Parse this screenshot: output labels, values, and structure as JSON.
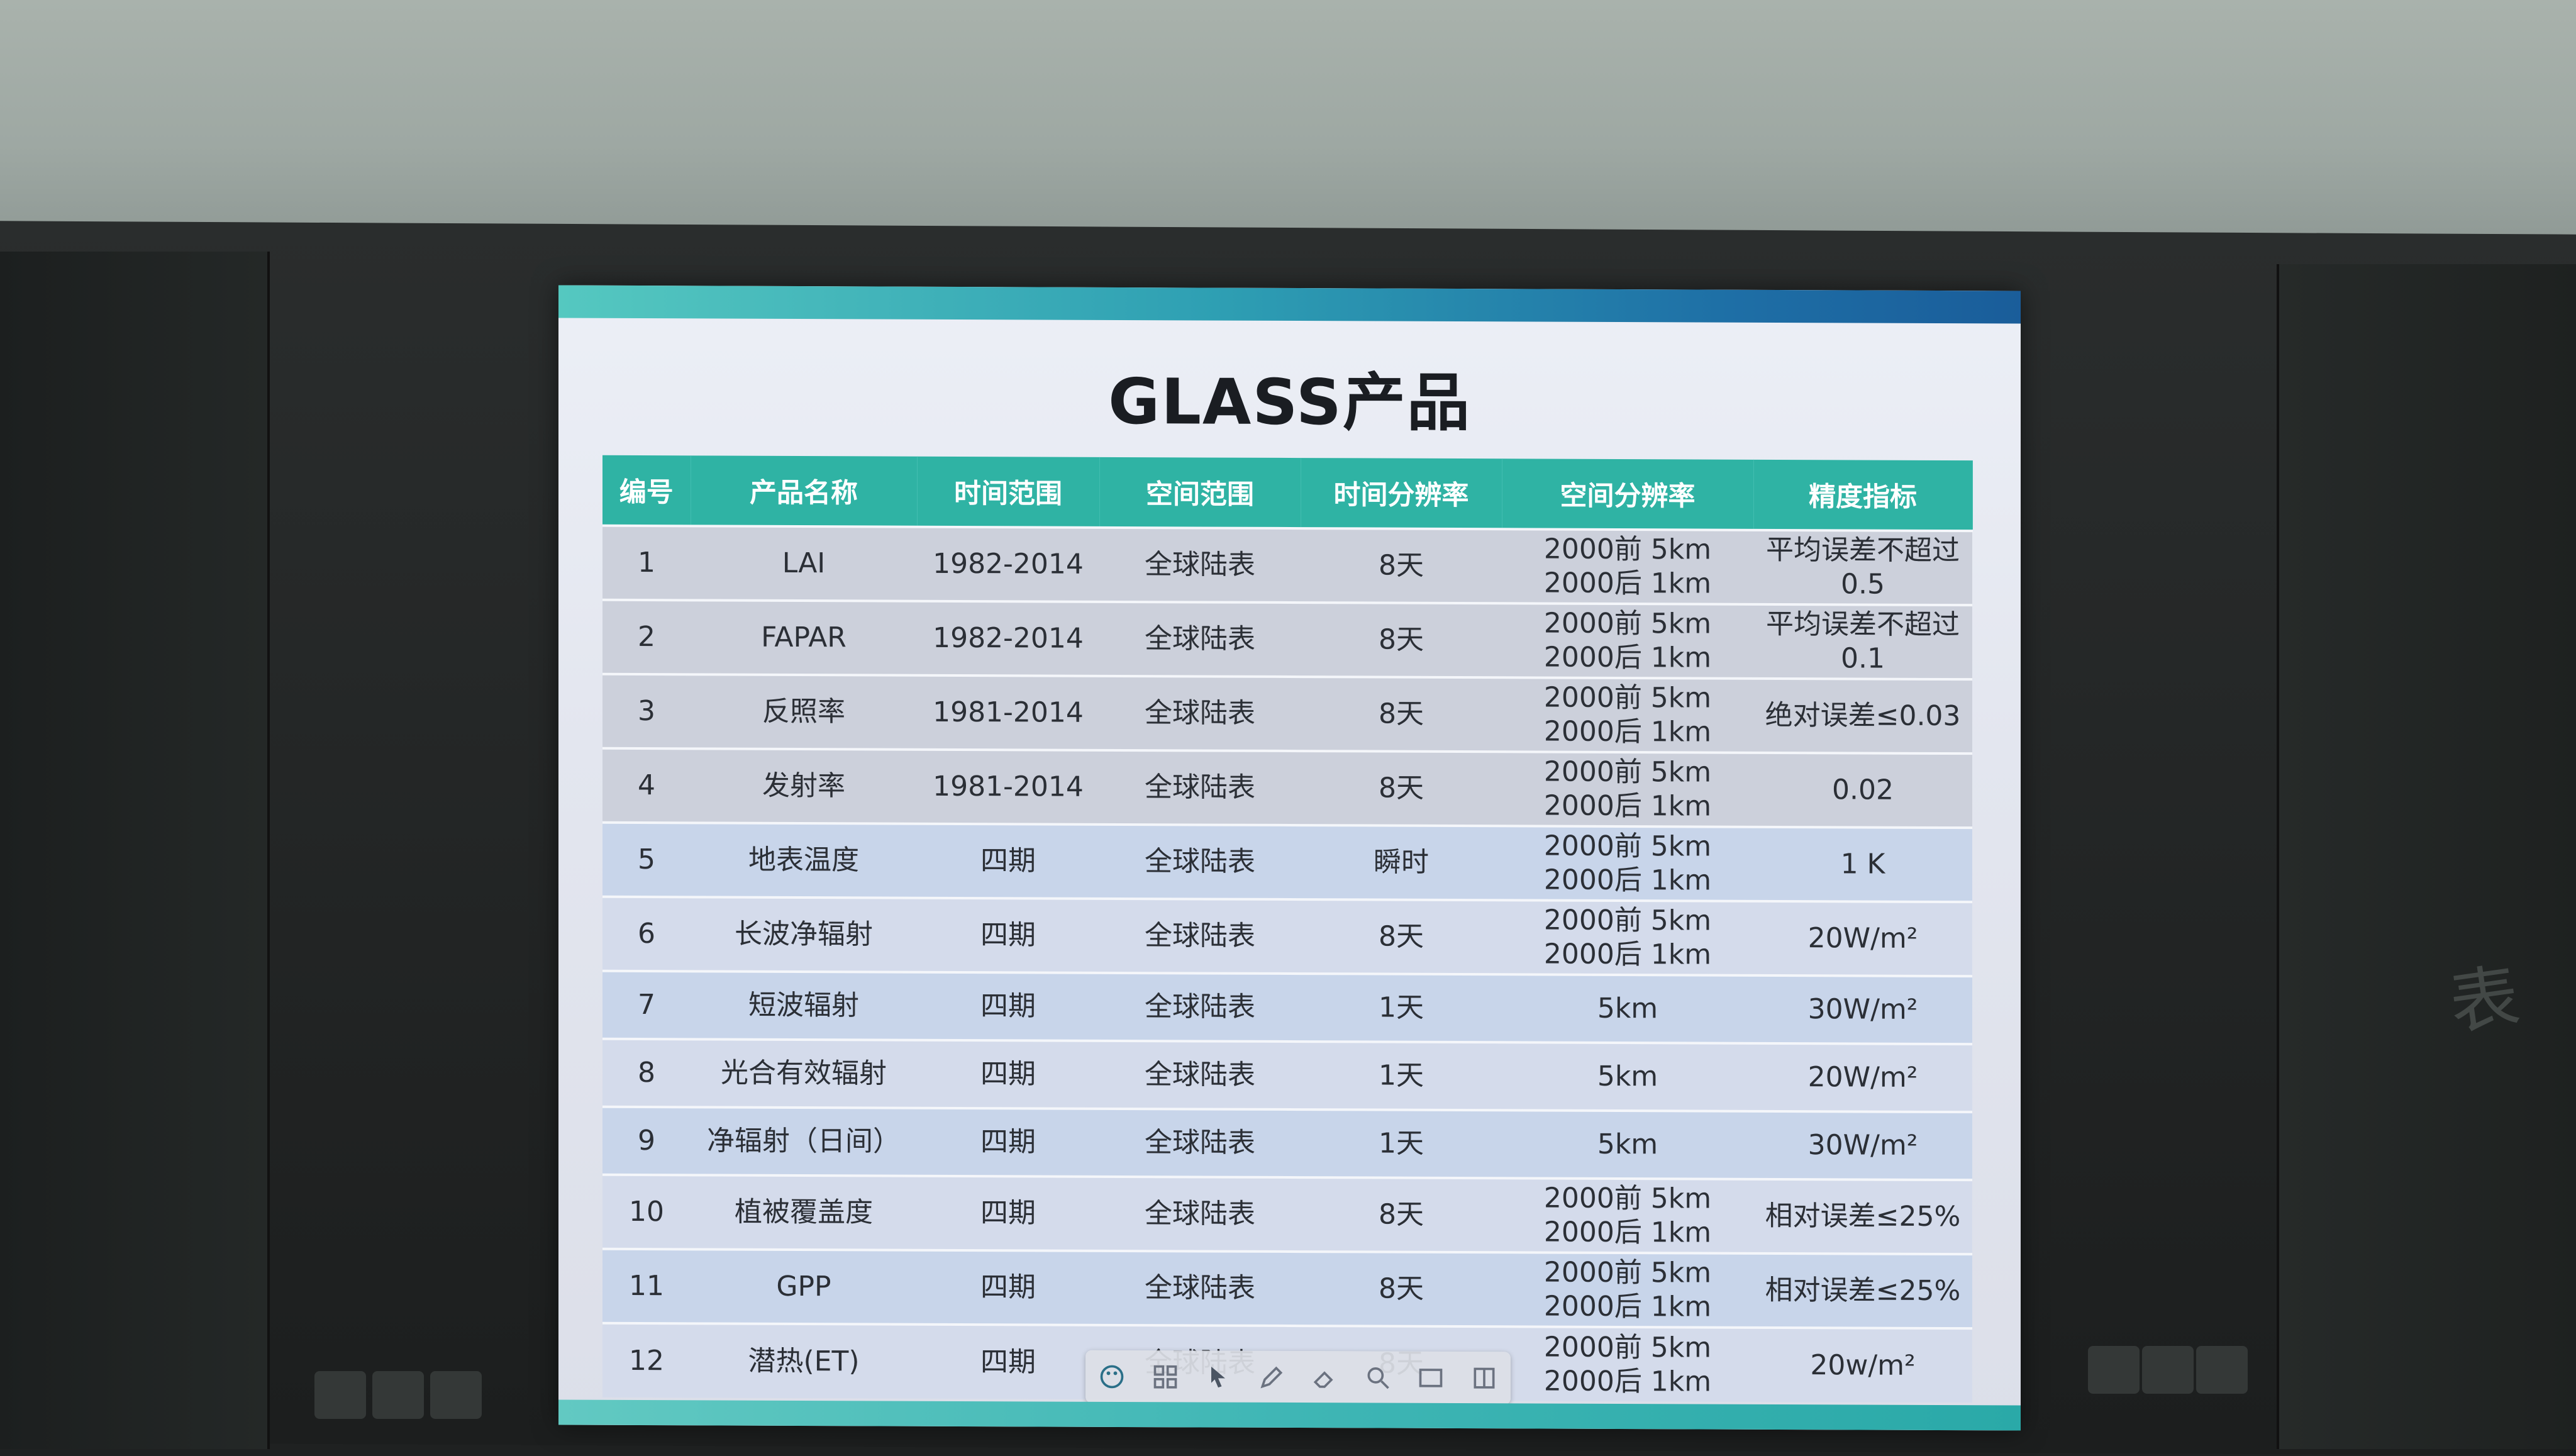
{
  "slide": {
    "title": "GLASS产品"
  },
  "table": {
    "headers": [
      "编号",
      "产品名称",
      "时间范围",
      "空间范围",
      "时间分辨率",
      "空间分辨率",
      "精度指标"
    ],
    "rows": [
      {
        "id": "1",
        "name": "LAI",
        "time_range": "1982-2014",
        "space_range": "全球陆表",
        "time_res": "8天",
        "space_res": [
          "2000前 5km",
          "2000后 1km"
        ],
        "accuracy": [
          "平均误差不超过",
          "0.5"
        ]
      },
      {
        "id": "2",
        "name": "FAPAR",
        "time_range": "1982-2014",
        "space_range": "全球陆表",
        "time_res": "8天",
        "space_res": [
          "2000前 5km",
          "2000后 1km"
        ],
        "accuracy": [
          "平均误差不超过",
          "0.1"
        ]
      },
      {
        "id": "3",
        "name": "反照率",
        "time_range": "1981-2014",
        "space_range": "全球陆表",
        "time_res": "8天",
        "space_res": [
          "2000前 5km",
          "2000后 1km"
        ],
        "accuracy": [
          "绝对误差≤0.03"
        ]
      },
      {
        "id": "4",
        "name": "发射率",
        "time_range": "1981-2014",
        "space_range": "全球陆表",
        "time_res": "8天",
        "space_res": [
          "2000前 5km",
          "2000后 1km"
        ],
        "accuracy": [
          "0.02"
        ]
      },
      {
        "id": "5",
        "name": "地表温度",
        "time_range": "四期",
        "space_range": "全球陆表",
        "time_res": "瞬时",
        "space_res": [
          "2000前 5km",
          "2000后 1km"
        ],
        "accuracy": [
          "1 K"
        ]
      },
      {
        "id": "6",
        "name": "长波净辐射",
        "time_range": "四期",
        "space_range": "全球陆表",
        "time_res": "8天",
        "space_res": [
          "2000前 5km",
          "2000后 1km"
        ],
        "accuracy": [
          "20W/m²"
        ]
      },
      {
        "id": "7",
        "name": "短波辐射",
        "time_range": "四期",
        "space_range": "全球陆表",
        "time_res": "1天",
        "space_res": [
          "5km"
        ],
        "accuracy": [
          "30W/m²"
        ]
      },
      {
        "id": "8",
        "name": "光合有效辐射",
        "time_range": "四期",
        "space_range": "全球陆表",
        "time_res": "1天",
        "space_res": [
          "5km"
        ],
        "accuracy": [
          "20W/m²"
        ]
      },
      {
        "id": "9",
        "name": "净辐射（日间）",
        "time_range": "四期",
        "space_range": "全球陆表",
        "time_res": "1天",
        "space_res": [
          "5km"
        ],
        "accuracy": [
          "30W/m²"
        ]
      },
      {
        "id": "10",
        "name": "植被覆盖度",
        "time_range": "四期",
        "space_range": "全球陆表",
        "time_res": "8天",
        "space_res": [
          "2000前 5km",
          "2000后 1km"
        ],
        "accuracy": [
          "相对误差≤25%"
        ]
      },
      {
        "id": "11",
        "name": "GPP",
        "time_range": "四期",
        "space_range": "全球陆表",
        "time_res": "8天",
        "space_res": [
          "2000前 5km",
          "2000后 1km"
        ],
        "accuracy": [
          "相对误差≤25%"
        ]
      },
      {
        "id": "12",
        "name": "潜热(ET)",
        "time_range": "四期",
        "space_range": "全球陆表",
        "time_res": "8天",
        "space_res": [
          "2000前 5km",
          "2000后 1km"
        ],
        "accuracy": [
          "20w/m²"
        ]
      }
    ],
    "row_styles": [
      "g",
      "g",
      "g",
      "g",
      "b1",
      "b2",
      "b1",
      "b2",
      "b1",
      "b2",
      "b1",
      "b2"
    ]
  },
  "toolbar": {
    "icons": [
      "palette-icon",
      "grid-icon",
      "pointer-icon",
      "pen-icon",
      "eraser-icon",
      "search-icon",
      "window-icon",
      "menu-icon"
    ]
  },
  "chalkboard": {
    "note": "表"
  },
  "colors": {
    "header_teal": "#2fb3a4",
    "row_gray": "#ccd0db",
    "row_blue": "#c8d5ea",
    "stripe_start": "#55c8c0",
    "stripe_end": "#1a5d9a"
  }
}
